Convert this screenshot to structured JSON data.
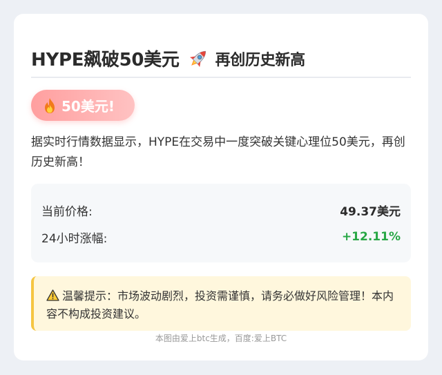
{
  "article": {
    "title_main": "HYPE飙破50美元",
    "title_icon": "rocket-icon",
    "title_sub": "再创历史新高",
    "badge": {
      "icon": "fire-icon",
      "label": "50美元!"
    },
    "description": "据实时行情数据显示，HYPE在交易中一度突破关键心理位50美元，再创历史新高！",
    "price": {
      "current_label": "当前价格:",
      "current_value": "49.37美元",
      "change_label": "24小时涨幅:",
      "change_value": "+12.11%"
    },
    "warning": {
      "icon": "warning-icon",
      "text": "温馨提示：市场波动剧烈，投资需谨慎，请务必做好风险管理！本内容不构成投资建议。"
    },
    "footer": "本图由爱上btc生成，百度:爱上BTC"
  },
  "colors": {
    "background": "#edf0f5",
    "card": "#ffffff",
    "badge_gradient_start": "#ff9f9f",
    "badge_gradient_end": "#ffc2c2",
    "positive_change": "#28a745",
    "warning_background": "#fff7dd",
    "warning_border": "#f5c542"
  }
}
